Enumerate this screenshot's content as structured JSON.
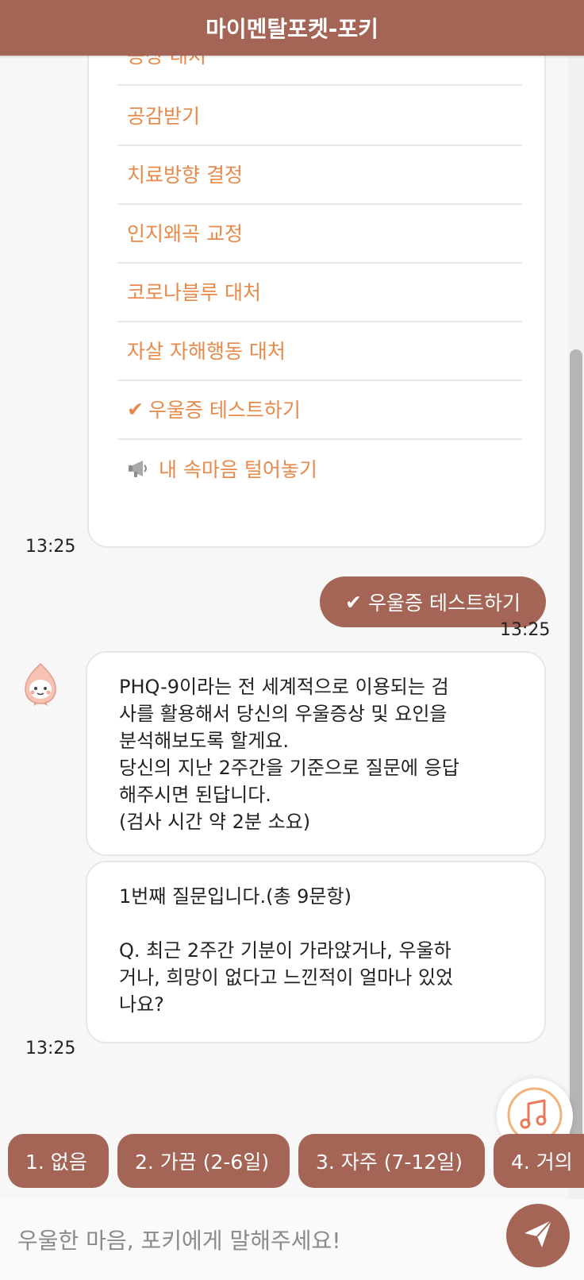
{
  "header": {
    "title": "마이멘탈포켓-포키"
  },
  "menu": {
    "items": [
      {
        "label": "증상 대처"
      },
      {
        "label": "공감받기"
      },
      {
        "label": "치료방향 결정"
      },
      {
        "label": "인지왜곡 교정"
      },
      {
        "label": "코로나블루 대처"
      },
      {
        "label": "자살 자해행동 대처"
      },
      {
        "label": "우울증 테스트하기",
        "icon": "check-icon",
        "mark": "✔"
      },
      {
        "label": "내 속마음 털어놓기",
        "icon": "megaphone-icon"
      }
    ],
    "time": "13:25"
  },
  "user_message": {
    "mark": "✔",
    "text": "우울증 테스트하기",
    "time": "13:25"
  },
  "bot_intro": {
    "lines": [
      "PHQ-9이라는 전 세계적으로 이용되는 검",
      "사를 활용해서 당신의 우울증상 및 요인을",
      "분석해보도록 할게요.",
      "당신의 지난 2주간을 기준으로 질문에 응답",
      "해주시면 된답니다.",
      "(검사 시간 약 2분 소요)"
    ]
  },
  "bot_question": {
    "header": "1번째 질문입니다.(총 9문항)",
    "question_lines": [
      "Q. 최근 2주간 기분이 가라앉거나, 우울하",
      "거나, 희망이 없다고 느낀적이 얼마나 있었",
      "나요?"
    ],
    "time": "13:25"
  },
  "quick_replies": [
    {
      "label": "1. 없음"
    },
    {
      "label": "2. 가끔 (2-6일)"
    },
    {
      "label": "3. 자주 (7-12일)"
    },
    {
      "label": "4. 거의"
    }
  ],
  "input": {
    "placeholder": "우울한 마음, 포키에게 말해주세요!"
  },
  "colors": {
    "brand": "#a56556",
    "menu_text": "#e8894a",
    "background": "#f7f7f7"
  },
  "icons": {
    "send": "paper-plane-icon",
    "music": "music-note-icon",
    "avatar": "peach-mascot-avatar"
  }
}
